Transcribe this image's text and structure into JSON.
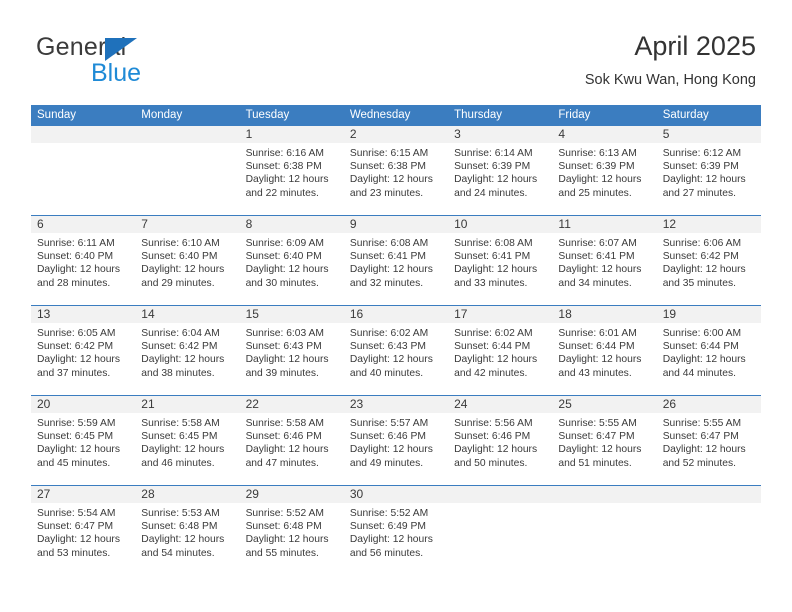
{
  "brand": {
    "name_top": "General",
    "name_bottom": "Blue",
    "triangle_color": "#1f71bb",
    "blue_text_color": "#1f8ad6"
  },
  "header": {
    "title": "April 2025",
    "subtitle": "Sok Kwu Wan, Hong Kong"
  },
  "theme": {
    "header_bar_color": "#3b7dc0",
    "daynum_band_color": "#f2f2f2",
    "row_divider_color": "#3b7dc0",
    "text_color": "#3a3a3a"
  },
  "weekday_headers": [
    "Sunday",
    "Monday",
    "Tuesday",
    "Wednesday",
    "Thursday",
    "Friday",
    "Saturday"
  ],
  "labels": {
    "sunrise_prefix": "Sunrise:",
    "sunset_prefix": "Sunset:",
    "daylight_prefix": "Daylight:"
  },
  "weeks": [
    [
      {
        "day": "",
        "sunrise": "",
        "sunset": "",
        "daylight_line1": "",
        "daylight_line2": "",
        "empty": true
      },
      {
        "day": "",
        "sunrise": "",
        "sunset": "",
        "daylight_line1": "",
        "daylight_line2": "",
        "empty": true
      },
      {
        "day": "1",
        "sunrise": "Sunrise: 6:16 AM",
        "sunset": "Sunset: 6:38 PM",
        "daylight_line1": "Daylight: 12 hours",
        "daylight_line2": "and 22 minutes.",
        "empty": false
      },
      {
        "day": "2",
        "sunrise": "Sunrise: 6:15 AM",
        "sunset": "Sunset: 6:38 PM",
        "daylight_line1": "Daylight: 12 hours",
        "daylight_line2": "and 23 minutes.",
        "empty": false
      },
      {
        "day": "3",
        "sunrise": "Sunrise: 6:14 AM",
        "sunset": "Sunset: 6:39 PM",
        "daylight_line1": "Daylight: 12 hours",
        "daylight_line2": "and 24 minutes.",
        "empty": false
      },
      {
        "day": "4",
        "sunrise": "Sunrise: 6:13 AM",
        "sunset": "Sunset: 6:39 PM",
        "daylight_line1": "Daylight: 12 hours",
        "daylight_line2": "and 25 minutes.",
        "empty": false
      },
      {
        "day": "5",
        "sunrise": "Sunrise: 6:12 AM",
        "sunset": "Sunset: 6:39 PM",
        "daylight_line1": "Daylight: 12 hours",
        "daylight_line2": "and 27 minutes.",
        "empty": false
      }
    ],
    [
      {
        "day": "6",
        "sunrise": "Sunrise: 6:11 AM",
        "sunset": "Sunset: 6:40 PM",
        "daylight_line1": "Daylight: 12 hours",
        "daylight_line2": "and 28 minutes.",
        "empty": false
      },
      {
        "day": "7",
        "sunrise": "Sunrise: 6:10 AM",
        "sunset": "Sunset: 6:40 PM",
        "daylight_line1": "Daylight: 12 hours",
        "daylight_line2": "and 29 minutes.",
        "empty": false
      },
      {
        "day": "8",
        "sunrise": "Sunrise: 6:09 AM",
        "sunset": "Sunset: 6:40 PM",
        "daylight_line1": "Daylight: 12 hours",
        "daylight_line2": "and 30 minutes.",
        "empty": false
      },
      {
        "day": "9",
        "sunrise": "Sunrise: 6:08 AM",
        "sunset": "Sunset: 6:41 PM",
        "daylight_line1": "Daylight: 12 hours",
        "daylight_line2": "and 32 minutes.",
        "empty": false
      },
      {
        "day": "10",
        "sunrise": "Sunrise: 6:08 AM",
        "sunset": "Sunset: 6:41 PM",
        "daylight_line1": "Daylight: 12 hours",
        "daylight_line2": "and 33 minutes.",
        "empty": false
      },
      {
        "day": "11",
        "sunrise": "Sunrise: 6:07 AM",
        "sunset": "Sunset: 6:41 PM",
        "daylight_line1": "Daylight: 12 hours",
        "daylight_line2": "and 34 minutes.",
        "empty": false
      },
      {
        "day": "12",
        "sunrise": "Sunrise: 6:06 AM",
        "sunset": "Sunset: 6:42 PM",
        "daylight_line1": "Daylight: 12 hours",
        "daylight_line2": "and 35 minutes.",
        "empty": false
      }
    ],
    [
      {
        "day": "13",
        "sunrise": "Sunrise: 6:05 AM",
        "sunset": "Sunset: 6:42 PM",
        "daylight_line1": "Daylight: 12 hours",
        "daylight_line2": "and 37 minutes.",
        "empty": false
      },
      {
        "day": "14",
        "sunrise": "Sunrise: 6:04 AM",
        "sunset": "Sunset: 6:42 PM",
        "daylight_line1": "Daylight: 12 hours",
        "daylight_line2": "and 38 minutes.",
        "empty": false
      },
      {
        "day": "15",
        "sunrise": "Sunrise: 6:03 AM",
        "sunset": "Sunset: 6:43 PM",
        "daylight_line1": "Daylight: 12 hours",
        "daylight_line2": "and 39 minutes.",
        "empty": false
      },
      {
        "day": "16",
        "sunrise": "Sunrise: 6:02 AM",
        "sunset": "Sunset: 6:43 PM",
        "daylight_line1": "Daylight: 12 hours",
        "daylight_line2": "and 40 minutes.",
        "empty": false
      },
      {
        "day": "17",
        "sunrise": "Sunrise: 6:02 AM",
        "sunset": "Sunset: 6:44 PM",
        "daylight_line1": "Daylight: 12 hours",
        "daylight_line2": "and 42 minutes.",
        "empty": false
      },
      {
        "day": "18",
        "sunrise": "Sunrise: 6:01 AM",
        "sunset": "Sunset: 6:44 PM",
        "daylight_line1": "Daylight: 12 hours",
        "daylight_line2": "and 43 minutes.",
        "empty": false
      },
      {
        "day": "19",
        "sunrise": "Sunrise: 6:00 AM",
        "sunset": "Sunset: 6:44 PM",
        "daylight_line1": "Daylight: 12 hours",
        "daylight_line2": "and 44 minutes.",
        "empty": false
      }
    ],
    [
      {
        "day": "20",
        "sunrise": "Sunrise: 5:59 AM",
        "sunset": "Sunset: 6:45 PM",
        "daylight_line1": "Daylight: 12 hours",
        "daylight_line2": "and 45 minutes.",
        "empty": false
      },
      {
        "day": "21",
        "sunrise": "Sunrise: 5:58 AM",
        "sunset": "Sunset: 6:45 PM",
        "daylight_line1": "Daylight: 12 hours",
        "daylight_line2": "and 46 minutes.",
        "empty": false
      },
      {
        "day": "22",
        "sunrise": "Sunrise: 5:58 AM",
        "sunset": "Sunset: 6:46 PM",
        "daylight_line1": "Daylight: 12 hours",
        "daylight_line2": "and 47 minutes.",
        "empty": false
      },
      {
        "day": "23",
        "sunrise": "Sunrise: 5:57 AM",
        "sunset": "Sunset: 6:46 PM",
        "daylight_line1": "Daylight: 12 hours",
        "daylight_line2": "and 49 minutes.",
        "empty": false
      },
      {
        "day": "24",
        "sunrise": "Sunrise: 5:56 AM",
        "sunset": "Sunset: 6:46 PM",
        "daylight_line1": "Daylight: 12 hours",
        "daylight_line2": "and 50 minutes.",
        "empty": false
      },
      {
        "day": "25",
        "sunrise": "Sunrise: 5:55 AM",
        "sunset": "Sunset: 6:47 PM",
        "daylight_line1": "Daylight: 12 hours",
        "daylight_line2": "and 51 minutes.",
        "empty": false
      },
      {
        "day": "26",
        "sunrise": "Sunrise: 5:55 AM",
        "sunset": "Sunset: 6:47 PM",
        "daylight_line1": "Daylight: 12 hours",
        "daylight_line2": "and 52 minutes.",
        "empty": false
      }
    ],
    [
      {
        "day": "27",
        "sunrise": "Sunrise: 5:54 AM",
        "sunset": "Sunset: 6:47 PM",
        "daylight_line1": "Daylight: 12 hours",
        "daylight_line2": "and 53 minutes.",
        "empty": false
      },
      {
        "day": "28",
        "sunrise": "Sunrise: 5:53 AM",
        "sunset": "Sunset: 6:48 PM",
        "daylight_line1": "Daylight: 12 hours",
        "daylight_line2": "and 54 minutes.",
        "empty": false
      },
      {
        "day": "29",
        "sunrise": "Sunrise: 5:52 AM",
        "sunset": "Sunset: 6:48 PM",
        "daylight_line1": "Daylight: 12 hours",
        "daylight_line2": "and 55 minutes.",
        "empty": false
      },
      {
        "day": "30",
        "sunrise": "Sunrise: 5:52 AM",
        "sunset": "Sunset: 6:49 PM",
        "daylight_line1": "Daylight: 12 hours",
        "daylight_line2": "and 56 minutes.",
        "empty": false
      },
      {
        "day": "",
        "sunrise": "",
        "sunset": "",
        "daylight_line1": "",
        "daylight_line2": "",
        "empty": true
      },
      {
        "day": "",
        "sunrise": "",
        "sunset": "",
        "daylight_line1": "",
        "daylight_line2": "",
        "empty": true
      },
      {
        "day": "",
        "sunrise": "",
        "sunset": "",
        "daylight_line1": "",
        "daylight_line2": "",
        "empty": true
      }
    ]
  ]
}
